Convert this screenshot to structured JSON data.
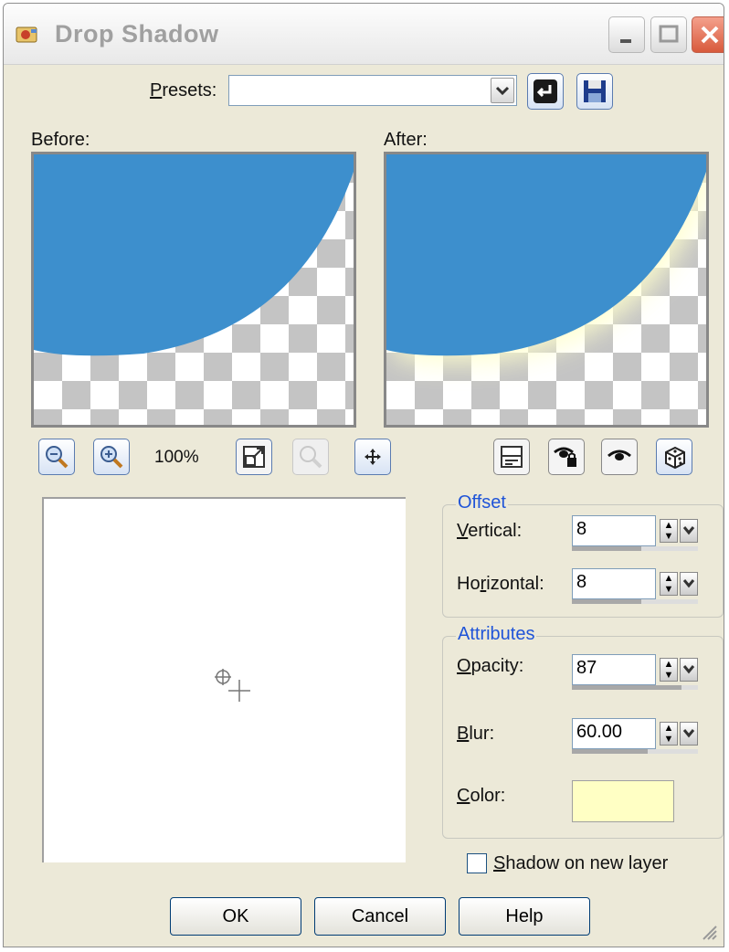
{
  "window": {
    "title": "Drop Shadow"
  },
  "presets": {
    "label_prefix": "P",
    "label_rest": "resets:",
    "value": ""
  },
  "preview": {
    "before_label": "Before:",
    "after_label": "After:",
    "zoom": "100%",
    "object_color": "#3d8fcd",
    "shadow_color": "#ffffcc"
  },
  "offset": {
    "title": "Offset",
    "vertical_label_u": "V",
    "vertical_label_rest": "ertical:",
    "vertical_value": "8",
    "vertical_fraction": 0.55,
    "horizontal_label_pre": "Ho",
    "horizontal_label_u": "r",
    "horizontal_label_rest": "izontal:",
    "horizontal_value": "8",
    "horizontal_fraction": 0.55
  },
  "attributes": {
    "title": "Attributes",
    "opacity_label_u": "O",
    "opacity_label_rest": "pacity:",
    "opacity_value": "87",
    "opacity_fraction": 0.87,
    "blur_label_u": "B",
    "blur_label_rest": "lur:",
    "blur_value": "60.00",
    "blur_fraction": 0.6,
    "color_label_u": "C",
    "color_label_rest": "olor:",
    "color_value": "#ffffc4"
  },
  "shadow_new_layer": {
    "label_u": "S",
    "label_rest": "hadow on new layer",
    "checked": false
  },
  "buttons": {
    "ok": "OK",
    "cancel": "Cancel",
    "help": "Help"
  }
}
